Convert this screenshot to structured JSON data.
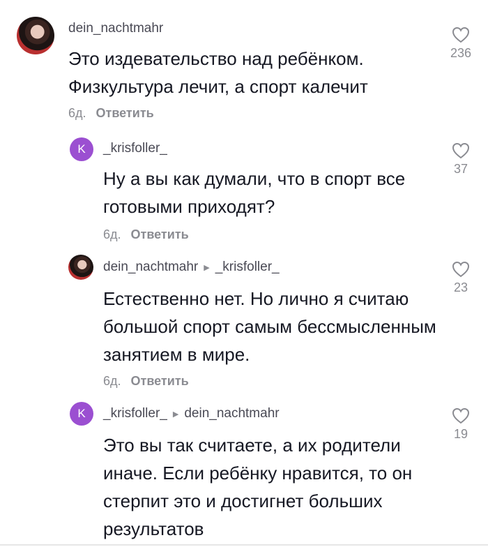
{
  "comments": [
    {
      "username": "dein_nachtmahr",
      "reply_to": "",
      "avatar": "photo",
      "avatar_letter": "",
      "text": "Это издевательство над ребёнком. Физкультура лечит, а спорт калечит",
      "time": "6д.",
      "reply_label": "Ответить",
      "likes": "236"
    },
    {
      "username": "_krisfoller_",
      "reply_to": "",
      "avatar": "letter",
      "avatar_letter": "K",
      "text": "Ну а вы как думали, что в спорт все готовыми приходят?",
      "time": "6д.",
      "reply_label": "Ответить",
      "likes": "37"
    },
    {
      "username": "dein_nachtmahr",
      "reply_to": "_krisfoller_",
      "avatar": "photo",
      "avatar_letter": "",
      "text": "Естественно нет. Но лично я считаю большой спорт самым бессмысленным занятием в мире.",
      "time": "6д.",
      "reply_label": "Ответить",
      "likes": "23"
    },
    {
      "username": "_krisfoller_",
      "reply_to": "dein_nachtmahr",
      "avatar": "letter",
      "avatar_letter": "K",
      "text": "Это вы так считаете, а их родители иначе. Если ребёнку нравится, то он стерпит это и достигнет больших результатов",
      "time": "",
      "reply_label": "",
      "likes": "19"
    }
  ],
  "icons": {
    "like": "heart-outline-icon",
    "reply_arrow": "triangle-right-icon"
  },
  "colors": {
    "avatar_letter_bg": "#9b4fd1",
    "text": "#161823",
    "muted": "#8a8b91"
  }
}
